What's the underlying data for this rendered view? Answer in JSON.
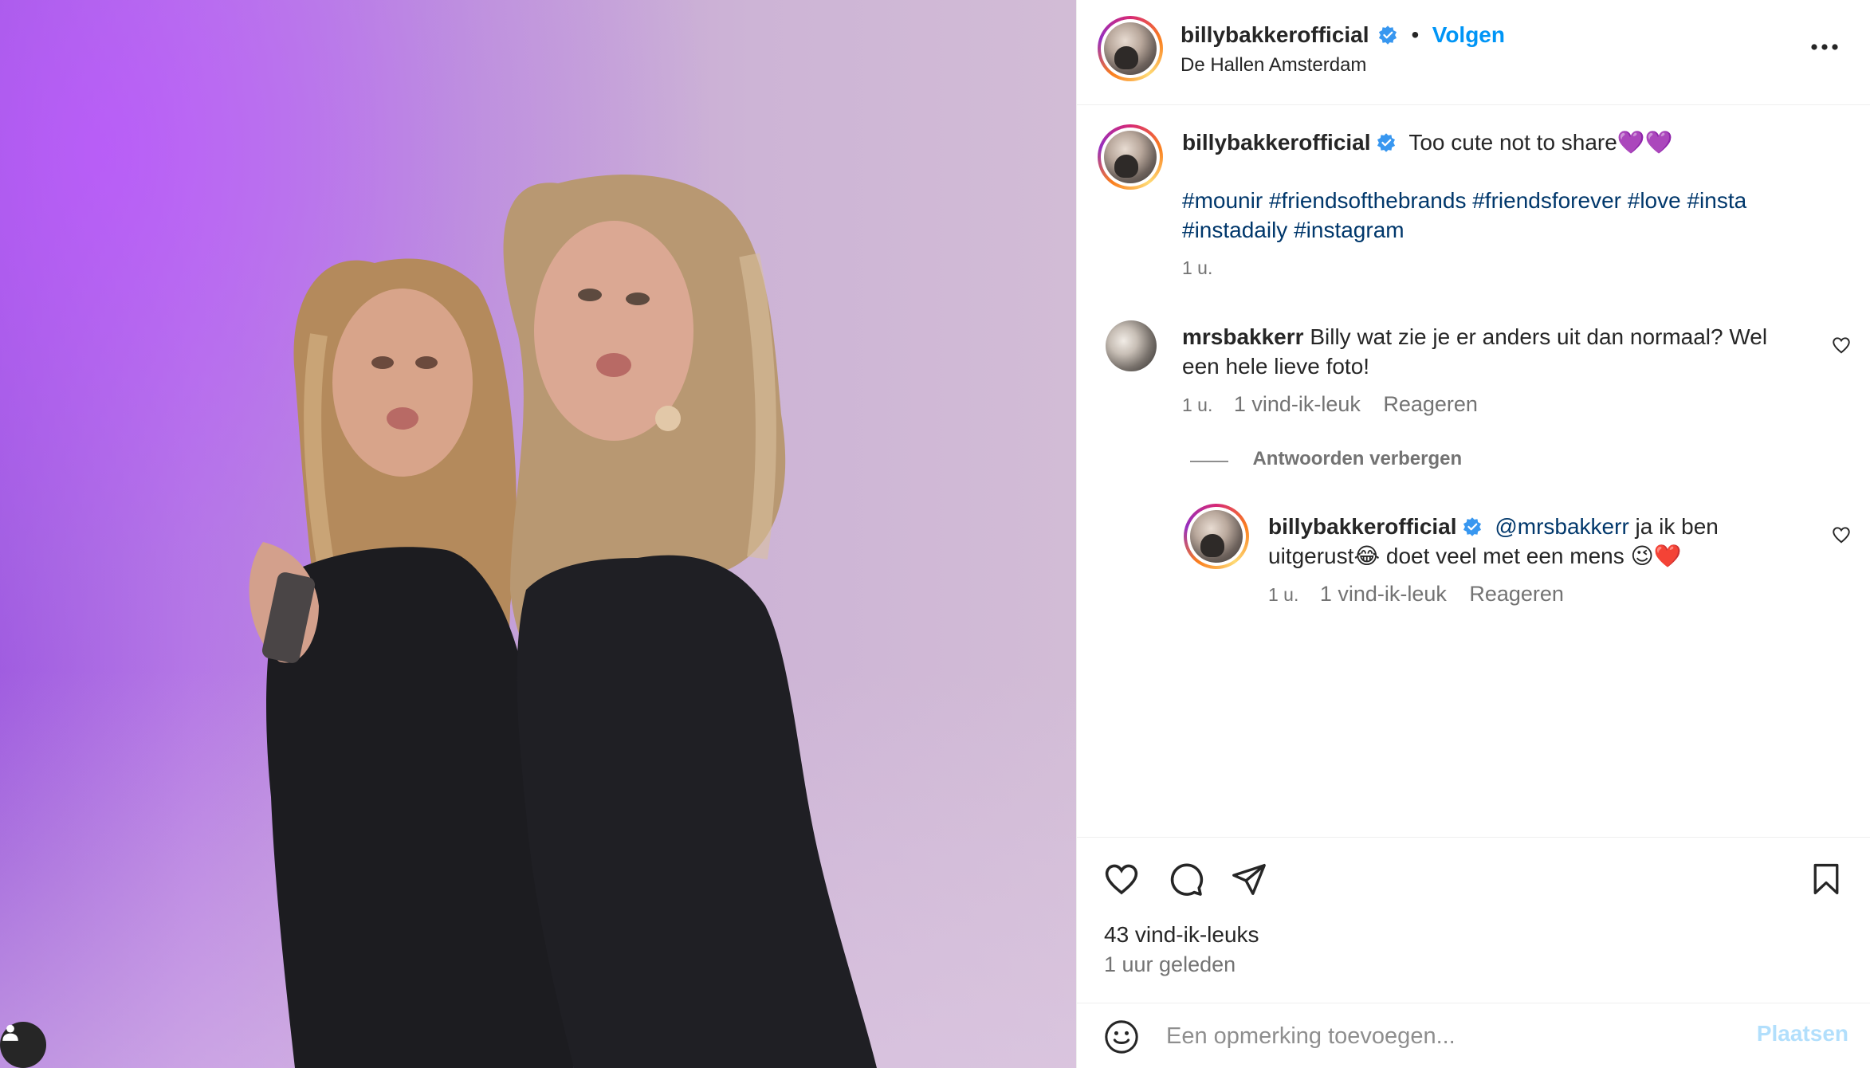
{
  "post": {
    "username": "billybakkerofficial",
    "follow_label": "Volgen",
    "separator": "•",
    "location": "De Hallen Amsterdam",
    "more_label": "•••"
  },
  "caption": {
    "username": "billybakkerofficial",
    "text": "Too cute not to share💜💜",
    "hashtags_line1": "#mounir #friendsofthebrands #friendsforever #love #insta",
    "hashtags_line2": "#instadaily #instagram",
    "time": "1 u."
  },
  "comments": [
    {
      "username": "mrsbakkerr",
      "text_line1": "Billy wat zie je er anders uit dan normaal? Wel",
      "text_line2": "een hele lieve foto!",
      "time": "1 u.",
      "likes": "1 vind-ik-leuk",
      "reply_label": "Reageren"
    }
  ],
  "replies_toggle": "Antwoorden verbergen",
  "reply": {
    "username": "billybakkerofficial",
    "mention": "@mrsbakkerr",
    "text_line1_rest": " ja ik ben",
    "text_line2": "uitgerust😂 doet veel met een mens 😉❤️",
    "time": "1 u.",
    "likes": "1 vind-ik-leuk",
    "reply_label": "Reageren"
  },
  "footer": {
    "likes": "43 vind-ik-leuks",
    "posted": "1 uur geleden"
  },
  "composer": {
    "placeholder": "Een opmerking toevoegen...",
    "post_label": "Plaatsen"
  },
  "colors": {
    "link_blue": "#0095f6",
    "hashtag": "#00376b",
    "verified": "#3897f0",
    "muted": "#737373"
  },
  "icons": [
    "verified-icon",
    "more-icon",
    "heart-icon",
    "comment-icon",
    "share-icon",
    "bookmark-icon",
    "emoji-icon",
    "user-icon"
  ]
}
